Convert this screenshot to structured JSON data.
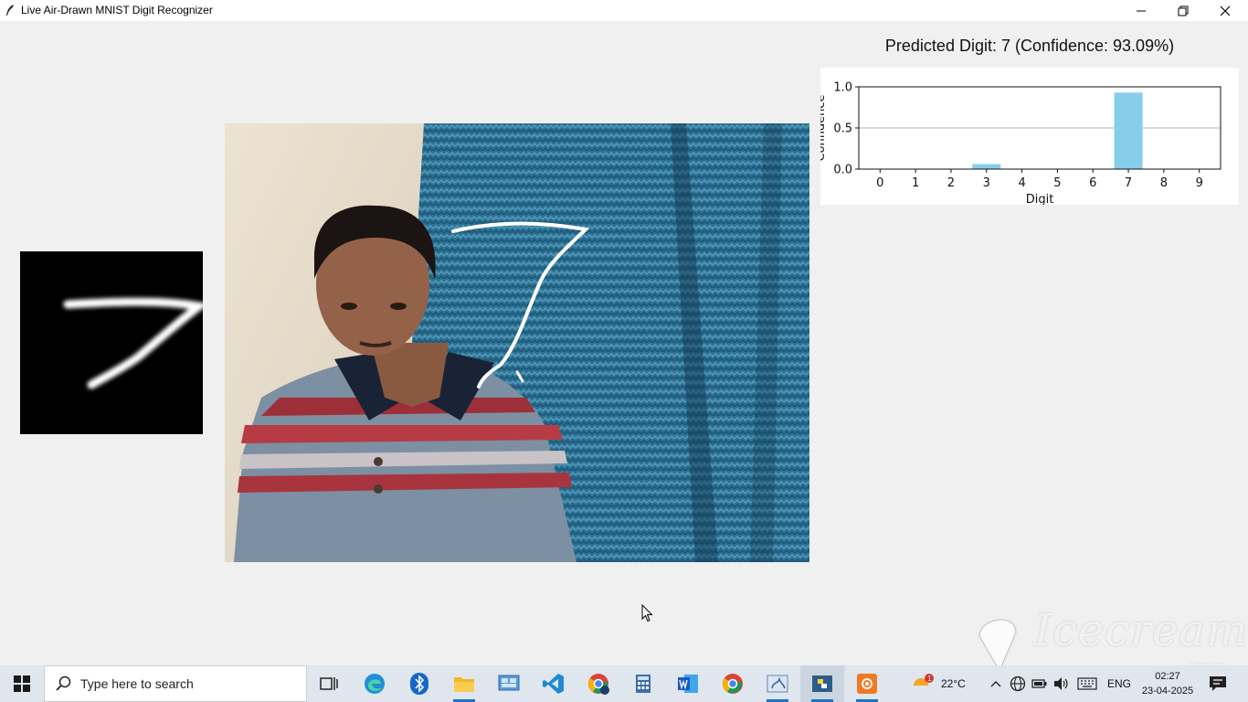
{
  "window": {
    "title": "Live Air-Drawn MNIST Digit Recognizer"
  },
  "prediction": {
    "text": "Predicted Digit: 7 (Confidence: 93.09%)"
  },
  "chart_data": {
    "type": "bar",
    "categories": [
      "0",
      "1",
      "2",
      "3",
      "4",
      "5",
      "6",
      "7",
      "8",
      "9"
    ],
    "values": [
      0.0,
      0.0,
      0.0,
      0.06,
      0.0,
      0.0,
      0.0,
      0.93,
      0.0,
      0.0
    ],
    "ylim": [
      0,
      1.0
    ],
    "yticks": [
      "0.0",
      "0.5",
      "1.0"
    ],
    "xlabel": "Digit",
    "ylabel": "Confidence",
    "bar_color": "#87ceeb",
    "grid": "horizontal"
  },
  "taskbar": {
    "search_placeholder": "Type here to search",
    "weather": "22°C",
    "language": "ENG",
    "time": "02:27",
    "date": "23-04-2025",
    "notification_badge": "1"
  },
  "watermark": {
    "brand": "Icecream",
    "sub": "APPS"
  },
  "colors": {
    "accent": "#1a73c9",
    "bar": "#87ceeb"
  }
}
